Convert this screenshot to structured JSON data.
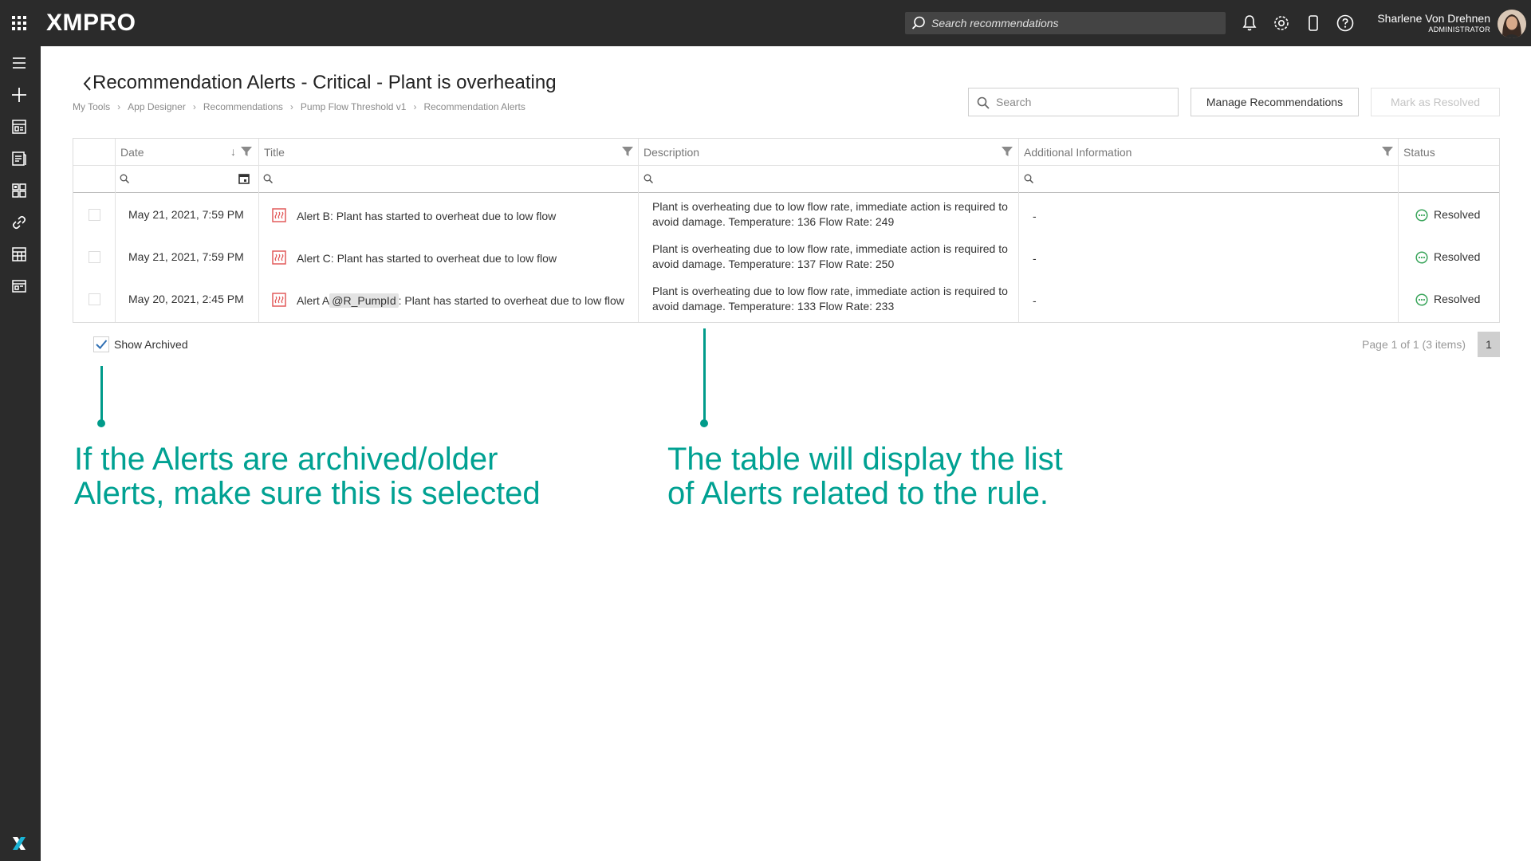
{
  "app": {
    "logo": "XMPRO",
    "search_placeholder": "Search recommendations",
    "user_name": "Sharlene Von Drehnen",
    "user_role": "ADMINISTRATOR"
  },
  "page": {
    "title": "Recommendation Alerts - Critical - Plant is overheating",
    "breadcrumb": [
      "My Tools",
      "App Designer",
      "Recommendations",
      "Pump Flow Threshold v1",
      "Recommendation Alerts"
    ],
    "search_placeholder": "Search",
    "manage_button": "Manage Recommendations",
    "resolve_button": "Mark as Resolved"
  },
  "table": {
    "columns": [
      "Date",
      "Title",
      "Description",
      "Additional Information",
      "Status"
    ],
    "rows": [
      {
        "date": "May 21, 2021, 7:59 PM",
        "title": "Alert B: Plant has started to overheat due to low flow",
        "description": "Plant is overheating due to low flow rate, immediate action is required to avoid damage. Temperature: 136 Flow Rate: 249",
        "additional": "-",
        "status": "Resolved"
      },
      {
        "date": "May 21, 2021, 7:59 PM",
        "title": "Alert C: Plant has started to overheat due to low flow",
        "description": "Plant is overheating due to low flow rate, immediate action is required to avoid damage. Temperature: 137 Flow Rate: 250",
        "additional": "-",
        "status": "Resolved"
      },
      {
        "date": "May 20, 2021, 2:45 PM",
        "title_prefix": "Alert A",
        "title_tag": "@R_PumpId",
        "title_suffix": ": Plant has started to overheat due to low flow",
        "description": "Plant is overheating due to low flow rate, immediate action is required to avoid damage. Temperature: 133 Flow Rate: 233",
        "additional": "-",
        "status": "Resolved"
      }
    ]
  },
  "footer": {
    "show_archived_label": "Show Archived",
    "show_archived_checked": true,
    "pager_info": "Page 1 of 1 (3 items)",
    "current_page": "1"
  },
  "annotations": {
    "left": [
      "If the Alerts are archived/older",
      "Alerts, make sure this is selected"
    ],
    "right": [
      "The table will display the list",
      "of Alerts related to the rule."
    ]
  },
  "colors": {
    "topbar": "#2b2b2b",
    "annotation": "#00a192",
    "status_green": "#3aa55b",
    "alert_red": "#e25b5b"
  },
  "icons": {
    "topbar": [
      "apps-grid-icon",
      "search-icon",
      "bell-icon",
      "gear-icon",
      "mobile-icon",
      "help-icon"
    ],
    "sidebar": [
      "menu-icon",
      "add-icon",
      "dashboard-icon",
      "recommendations-icon",
      "apps-icon",
      "link-icon",
      "calendar-icon",
      "layout-icon",
      "xmpro-logo-icon"
    ]
  }
}
